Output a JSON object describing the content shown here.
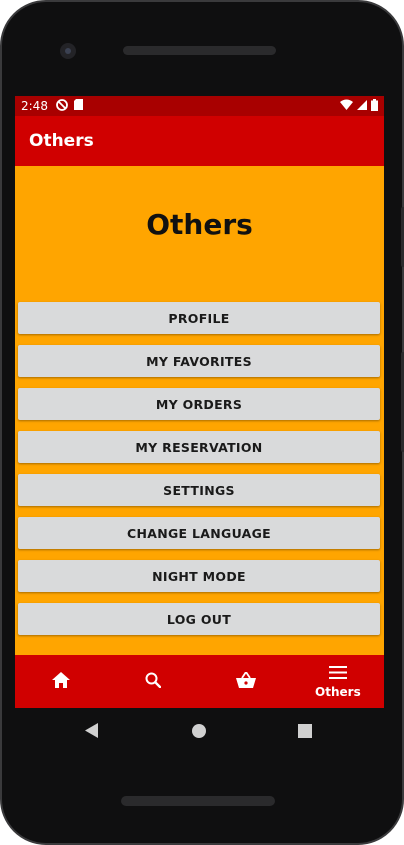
{
  "status_bar": {
    "time": "2:48",
    "left_icons": [
      "do-not-disturb-icon",
      "sd-card-icon"
    ],
    "right_icons": [
      "wifi-icon",
      "signal-icon",
      "battery-icon"
    ]
  },
  "app_bar": {
    "title": "Others"
  },
  "page": {
    "heading": "Others"
  },
  "menu": [
    {
      "label": "PROFILE"
    },
    {
      "label": "MY FAVORITES"
    },
    {
      "label": "MY ORDERS"
    },
    {
      "label": "MY RESERVATION"
    },
    {
      "label": "SETTINGS"
    },
    {
      "label": "CHANGE LANGUAGE"
    },
    {
      "label": "NIGHT MODE"
    },
    {
      "label": "LOG OUT"
    }
  ],
  "bottom_nav": {
    "items": [
      {
        "icon": "home-icon",
        "label": ""
      },
      {
        "icon": "search-icon",
        "label": ""
      },
      {
        "icon": "basket-icon",
        "label": ""
      },
      {
        "icon": "menu-icon",
        "label": "Others"
      }
    ],
    "active_index": 3
  },
  "system_nav": [
    "back-icon",
    "home-circle-icon",
    "recents-icon"
  ],
  "colors": {
    "status_bar": "#A80000",
    "app_bar": "#D00000",
    "background": "#FFA500",
    "button": "#D9DADB"
  }
}
